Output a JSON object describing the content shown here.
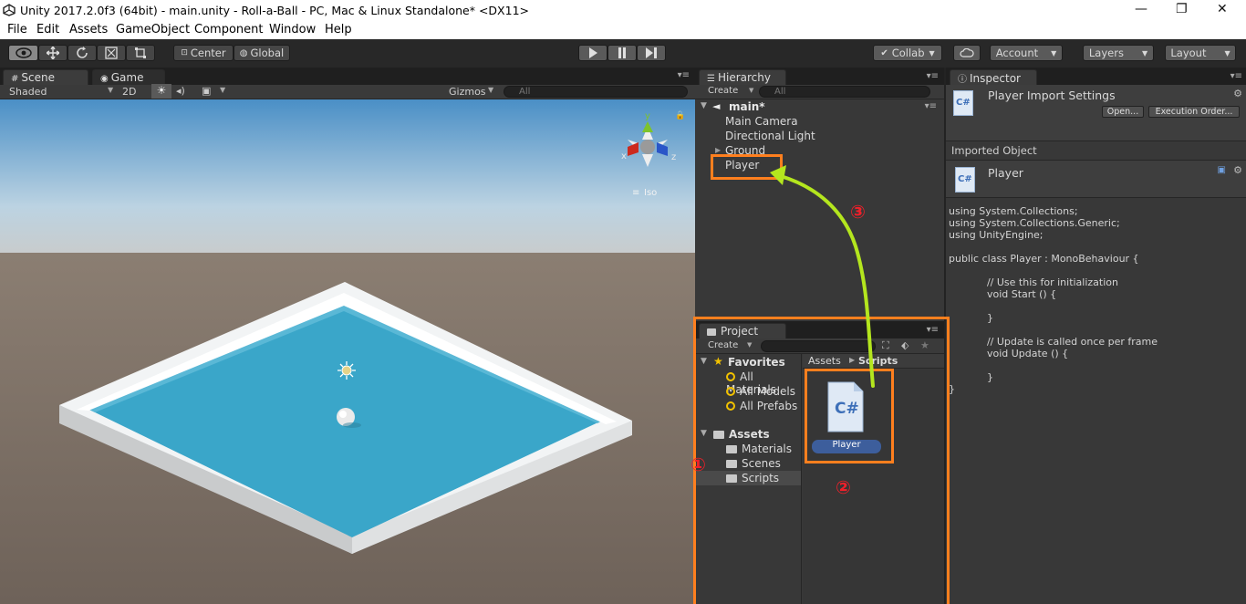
{
  "window": {
    "title": "Unity 2017.2.0f3 (64bit) - main.unity - Roll-a-Ball - PC, Mac & Linux Standalone* <DX11>",
    "controls": [
      "—",
      "❐",
      "✕"
    ]
  },
  "menu": [
    "File",
    "Edit",
    "Assets",
    "GameObject",
    "Component",
    "Window",
    "Help"
  ],
  "toolbar": {
    "pivot_label": "Center",
    "space_label": "Global",
    "collab_label": "Collab",
    "account_label": "Account",
    "layers_label": "Layers",
    "layout_label": "Layout",
    "play_icon": "play-icon",
    "pause_icon": "pause-icon",
    "step_icon": "step-icon"
  },
  "scene_panel": {
    "tab_scene": "Scene",
    "tab_game": "Game",
    "shading": "Shaded",
    "mode_2d": "2D",
    "gizmos": "Gizmos",
    "search_placeholder": "All",
    "gizmo_axes": {
      "y": "y",
      "x": "x",
      "z": "z"
    },
    "projection": "Iso"
  },
  "hierarchy": {
    "tab": "Hierarchy",
    "create": "Create",
    "search_placeholder": "All",
    "scene_name": "main*",
    "items": [
      "Main Camera",
      "Directional Light",
      "Ground",
      "Player"
    ]
  },
  "project": {
    "tab": "Project",
    "create": "Create",
    "favorites_label": "Favorites",
    "favorites": [
      "All Materials",
      "All Models",
      "All Prefabs"
    ],
    "assets_label": "Assets",
    "folders": [
      "Materials",
      "Scenes",
      "Scripts"
    ],
    "breadcrumb": [
      "Assets",
      "Scripts"
    ],
    "asset_name": "Player",
    "asset_icon_text": "C#"
  },
  "inspector": {
    "tab": "Inspector",
    "header_title": "Player Import Settings",
    "open_button": "Open...",
    "exec_order_button": "Execution Order...",
    "imported_object_label": "Imported Object",
    "object_name": "Player",
    "code_lines": [
      "using System.Collections;",
      "using System.Collections.Generic;",
      "using UnityEngine;",
      "",
      "public class Player : MonoBehaviour {",
      "",
      "            // Use this for initialization",
      "            void Start () {",
      "",
      "            }",
      "",
      "            // Update is called once per frame",
      "            void Update () {",
      "",
      "            }",
      "}"
    ]
  },
  "annotations": {
    "step1": "①",
    "step2": "②",
    "step3": "③",
    "highlight_color": "#ff7f1e",
    "arrow_color": "#b4e61e",
    "number_color": "#f0202a"
  }
}
